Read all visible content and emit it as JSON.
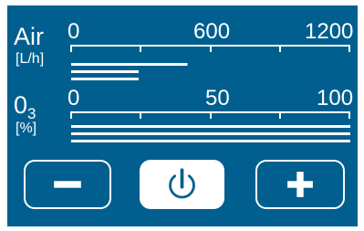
{
  "panel": {
    "air": {
      "label": "Air",
      "unit": "[L/h]",
      "scale_ticks": [
        "0",
        "600",
        "1200"
      ],
      "scale_max": 1200,
      "bars": [
        {
          "value": 500,
          "max": 1200
        },
        {
          "value": 290,
          "max": 1200
        },
        {
          "value": 290,
          "max": 1200
        }
      ]
    },
    "ozone": {
      "label": "0",
      "subscript": "3",
      "unit": "[%]",
      "scale_ticks": [
        "0",
        "50",
        "100"
      ],
      "scale_max": 100,
      "bars": [
        {
          "value": 100,
          "max": 100
        },
        {
          "value": 100,
          "max": 100
        },
        {
          "value": 100,
          "max": 100
        }
      ]
    }
  },
  "buttons": [
    {
      "icon": "minus-icon"
    },
    {
      "icon": "power-icon",
      "active": true
    },
    {
      "icon": "plus-icon"
    }
  ],
  "colors": {
    "background": "#005f8f",
    "foreground": "#ffffff"
  }
}
